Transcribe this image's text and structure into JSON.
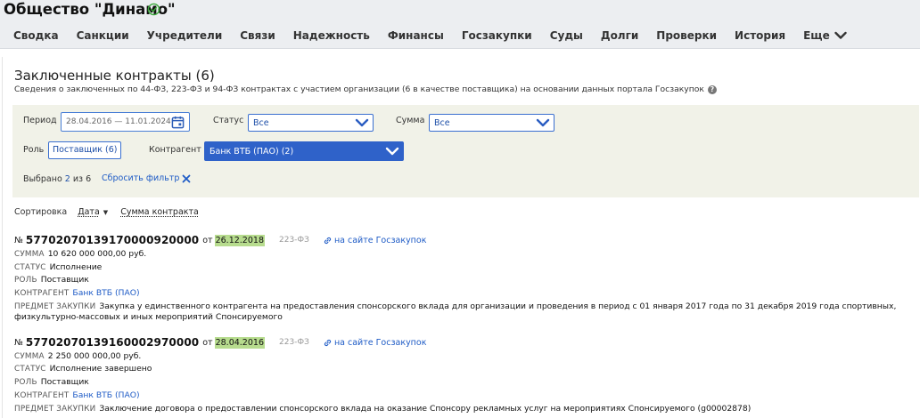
{
  "org": {
    "title": "Общество \"Динамо\""
  },
  "nav": {
    "items": [
      "Сводка",
      "Санкции",
      "Учредители",
      "Связи",
      "Надежность",
      "Финансы",
      "Госзакупки",
      "Суды",
      "Долги",
      "Проверки",
      "История"
    ],
    "more": "Еще"
  },
  "section": {
    "title": "Заключенные контракты (6)",
    "subtitle": "Сведения о заключенных по 44-ФЗ, 223-ФЗ и 94-ФЗ контрактах с участием организации (6 в качестве поставщика) на основании данных портала Госзакупок",
    "help": "?"
  },
  "filters": {
    "period_label": "Период",
    "period_value": "28.04.2016 — 11.01.2024",
    "status_label": "Статус",
    "status_value": "Все",
    "sum_label": "Сумма",
    "sum_value": "Все",
    "role_label": "Роль",
    "role_value": "Поставщик (6)",
    "counterparty_label": "Контрагент",
    "counterparty_value": "Банк ВТБ (ПАО) (2)",
    "selected_prefix": "Выбрано",
    "selected_count": "2",
    "selected_of": "из 6",
    "reset_label": "Сбросить фильтр"
  },
  "sort": {
    "label": "Сортировка",
    "by_date": "Дата",
    "by_sum": "Сумма контракта"
  },
  "contracts": [
    {
      "no_label": "№",
      "number": "57702070139170000920000",
      "from_label": "от",
      "date": "26.12.2018",
      "law": "223-ФЗ",
      "link": "на сайте Госзакупок",
      "sum_label": "СУММА",
      "sum": "10 620 000 000,00 руб.",
      "status_label": "СТАТУС",
      "status": "Исполнение",
      "role_label": "РОЛЬ",
      "role": "Поставщик",
      "counterparty_label": "КОНТРАГЕНТ",
      "counterparty": "Банк ВТБ (ПАО)",
      "subject_label": "ПРЕДМЕТ ЗАКУПКИ",
      "subject": "Закупка у единственного контрагента на предоставления спонсорского вклада для организации и проведения в период с 01 января 2017 года по 31 декабря 2019 года спортивных, физкультурно-массовых и иных мероприятий Спонсируемого"
    },
    {
      "no_label": "№",
      "number": "57702070139160002970000",
      "from_label": "от",
      "date": "28.04.2016",
      "law": "223-ФЗ",
      "link": "на сайте Госзакупок",
      "sum_label": "СУММА",
      "sum": "2 250 000 000,00 руб.",
      "status_label": "СТАТУС",
      "status": "Исполнение завершено",
      "role_label": "РОЛЬ",
      "role": "Поставщик",
      "counterparty_label": "КОНТРАГЕНТ",
      "counterparty": "Банк ВТБ (ПАО)",
      "subject_label": "ПРЕДМЕТ ЗАКУПКИ",
      "subject": "Заключение договора о предоставлении спонсорского вклада на оказание Спонсору рекламных услуг на мероприятиях Спонсируемого (g00002878)"
    }
  ]
}
